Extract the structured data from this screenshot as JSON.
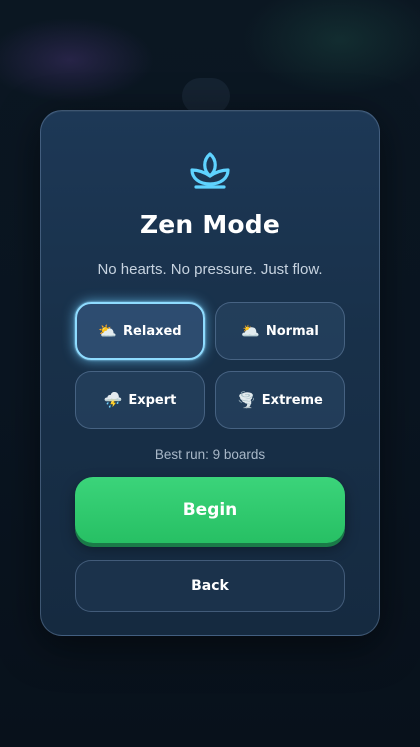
{
  "dialog": {
    "icon": "lotus-icon",
    "title": "Zen Mode",
    "subtitle": "No hearts. No pressure. Just flow.",
    "difficulties": [
      {
        "emoji": "⛅",
        "label": "Relaxed",
        "selected": true
      },
      {
        "emoji": "🌥️",
        "label": "Normal",
        "selected": false
      },
      {
        "emoji": "⛈️",
        "label": "Expert",
        "selected": false
      },
      {
        "emoji": "🌪️",
        "label": "Extreme",
        "selected": false
      }
    ],
    "best_run": "Best run: 9 boards",
    "begin_label": "Begin",
    "back_label": "Back"
  },
  "colors": {
    "accent_green": "#2ecc71",
    "selected_glow": "#8fdcff",
    "lotus": "#5fd3ff",
    "card_bg": "#1a3350"
  }
}
